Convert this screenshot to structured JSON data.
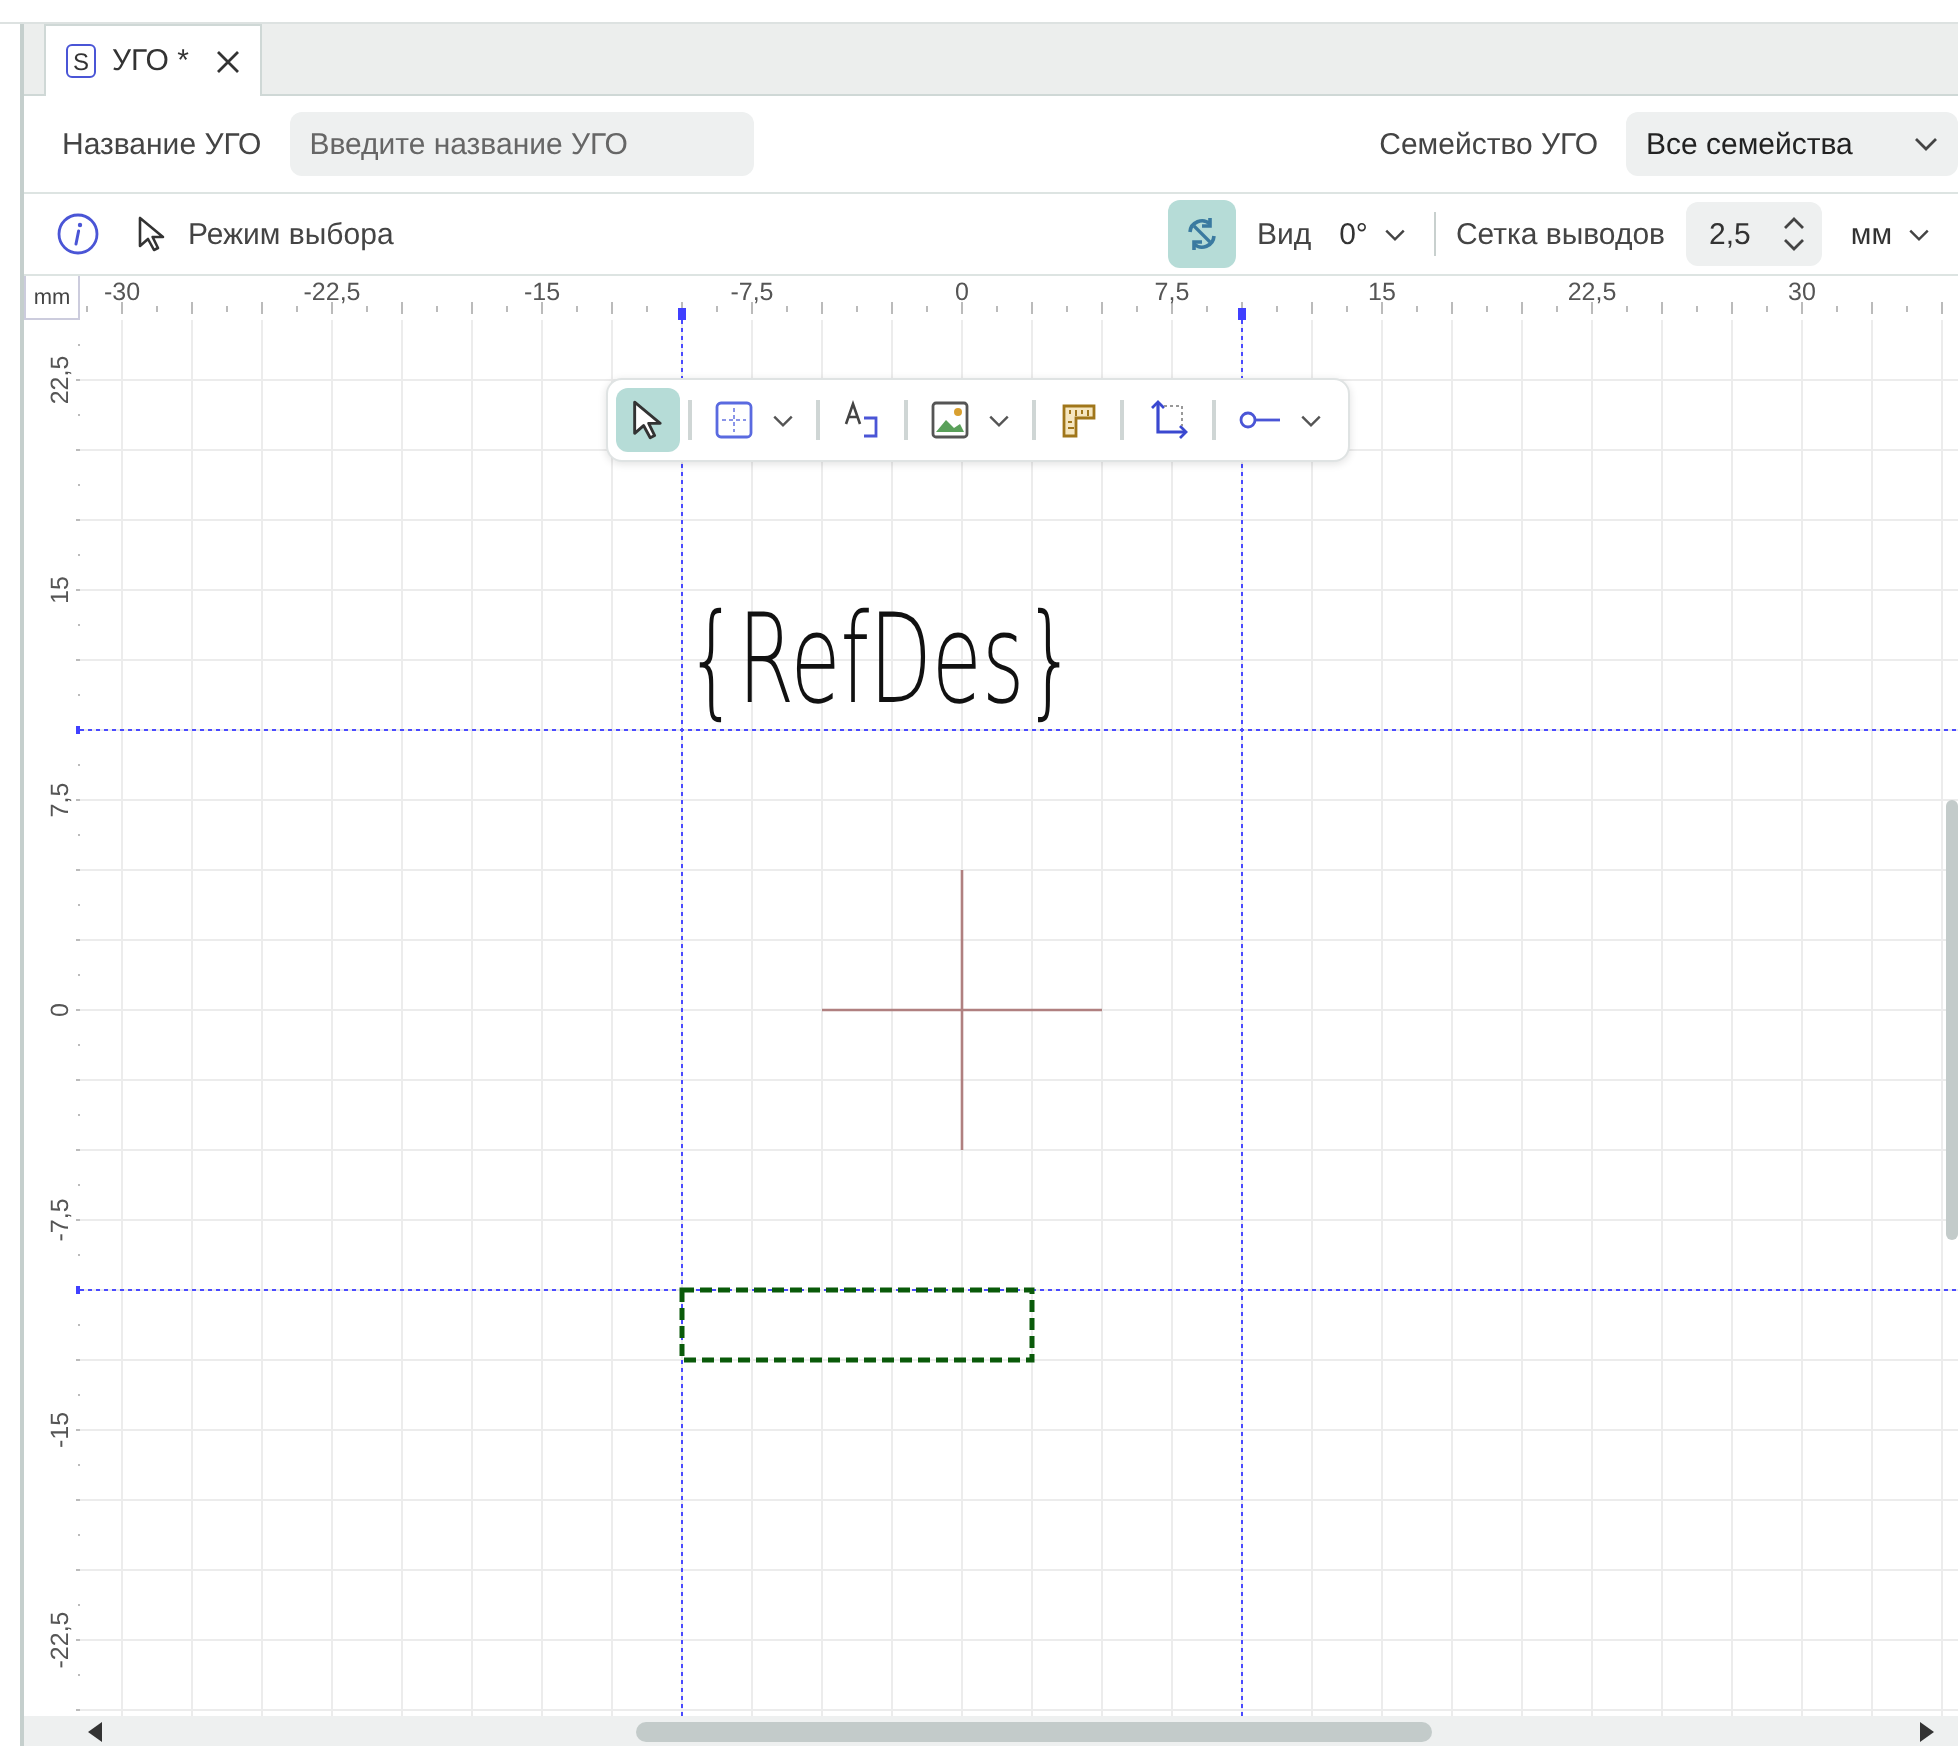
{
  "tabs": [
    {
      "icon_letter": "S",
      "label": "УГО *",
      "selected": true
    }
  ],
  "name_field": {
    "label": "Название УГО",
    "placeholder": "Введите название УГО"
  },
  "family_field": {
    "label": "Семейство УГО",
    "value": "Все семейства"
  },
  "toolbar": {
    "mode_label": "Режим выбора",
    "snap_toggle_on": true,
    "view_label": "Вид",
    "rotation": "0°",
    "grid_label": "Сетка выводов",
    "grid_value": "2,5",
    "unit": "мм"
  },
  "rulers": {
    "unit": "mm",
    "x_labels": [
      "-30",
      "-22,5",
      "-15",
      "-7,5",
      "0",
      "7,5",
      "15",
      "22,5",
      "30"
    ],
    "y_labels": [
      "22,5",
      "15",
      "7,5",
      "0",
      "-7,5",
      "-15",
      "-22,5"
    ]
  },
  "drawing_tools": [
    {
      "kind": "select",
      "selected": true,
      "dropdown": false
    },
    {
      "kind": "rectangle",
      "selected": false,
      "dropdown": true
    },
    {
      "kind": "text",
      "selected": false,
      "dropdown": false
    },
    {
      "kind": "image",
      "selected": false,
      "dropdown": true
    },
    {
      "kind": "ruler",
      "selected": false,
      "dropdown": false
    },
    {
      "kind": "frame",
      "selected": false,
      "dropdown": false
    },
    {
      "kind": "pin",
      "selected": false,
      "dropdown": true
    }
  ],
  "canvas": {
    "refdes": "{RefDes}"
  }
}
